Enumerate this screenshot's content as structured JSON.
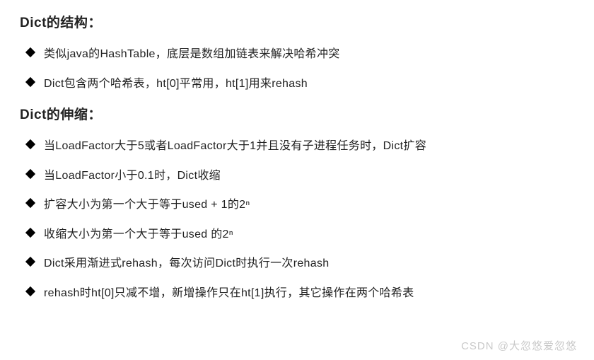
{
  "sections": [
    {
      "heading": "Dict的结构：",
      "items": [
        "类似java的HashTable，底层是数组加链表来解决哈希冲突",
        "Dict包含两个哈希表，ht[0]平常用，ht[1]用来rehash"
      ]
    },
    {
      "heading": "Dict的伸缩：",
      "items": [
        "当LoadFactor大于5或者LoadFactor大于1并且没有子进程任务时，Dict扩容",
        "当LoadFactor小于0.1时，Dict收缩",
        "扩容大小为第一个大于等于used + 1的2ⁿ",
        "收缩大小为第一个大于等于used 的2ⁿ",
        "Dict采用渐进式rehash，每次访问Dict时执行一次rehash",
        "rehash时ht[0]只减不增，新增操作只在ht[1]执行，其它操作在两个哈希表"
      ]
    }
  ],
  "watermark": "CSDN @大忽悠爱忽悠"
}
